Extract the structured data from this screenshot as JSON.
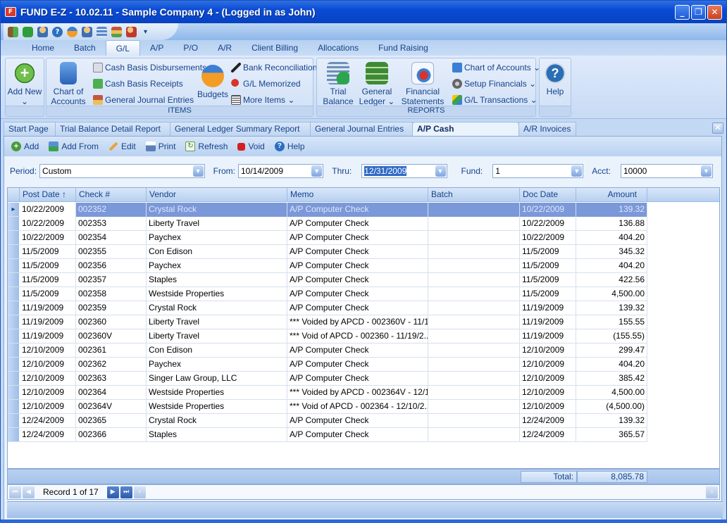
{
  "window": {
    "title": "FUND E-Z - 10.02.11 - Sample Company 4 - (Logged in as John)",
    "controls": {
      "minimize": "_",
      "restore": "❐",
      "close": "✕"
    }
  },
  "quick_access": {
    "icons": [
      "exit-icon",
      "database-icon",
      "user-icon",
      "help-icon",
      "budget-icon",
      "users-icon",
      "calculator-icon",
      "books-icon",
      "people-icon"
    ],
    "more": "▾"
  },
  "ribbon_tabs": [
    {
      "label": "Home"
    },
    {
      "label": "Batch"
    },
    {
      "label": "G/L",
      "active": true
    },
    {
      "label": "A/P"
    },
    {
      "label": "P/O"
    },
    {
      "label": "A/R"
    },
    {
      "label": "Client Billing"
    },
    {
      "label": "Allocations"
    },
    {
      "label": "Fund Raising"
    }
  ],
  "ribbon": {
    "add_new": {
      "line1": "Add New",
      "line2": "⌄"
    },
    "items_group": {
      "label": "ITEMS",
      "chart_of_accounts": {
        "line1": "Chart of",
        "line2": "Accounts ⌄"
      },
      "cash_basis_disbursements": "Cash Basis Disbursements",
      "cash_basis_receipts": "Cash Basis Receipts",
      "general_journal_entries": "General Journal Entries",
      "budgets": "Budgets",
      "bank_reconciliations": "Bank Reconciliations",
      "gl_memorized": "G/L Memorized",
      "more_items": "More Items ⌄"
    },
    "reports_group": {
      "label": "REPORTS",
      "trial_balance": {
        "line1": "Trial",
        "line2": "Balance ⌄"
      },
      "general_ledger": {
        "line1": "General",
        "line2": "Ledger ⌄"
      },
      "financial_statements": {
        "line1": "Financial",
        "line2": "Statements ⌄"
      },
      "chart_of_accounts": "Chart of Accounts ⌄",
      "setup_financials": "Setup Financials ⌄",
      "gl_transactions": "G/L Transactions ⌄"
    },
    "help": "Help"
  },
  "doc_tabs": [
    {
      "label": "Start Page"
    },
    {
      "label": "Trial Balance Detail Report"
    },
    {
      "label": "General Ledger Summary Report"
    },
    {
      "label": "General Journal Entries"
    },
    {
      "label": "A/P Cash Disbursements",
      "active": true
    },
    {
      "label": "A/R Invoices"
    }
  ],
  "toolbar": {
    "add": "Add",
    "add_from": "Add From",
    "edit": "Edit",
    "print": "Print",
    "refresh": "Refresh",
    "void": "Void",
    "help": "Help"
  },
  "filters": {
    "period_label": "Period:",
    "period": "Custom",
    "from_label": "From:",
    "from": "10/14/2009",
    "thru_label": "Thru:",
    "thru": "12/31/2009",
    "fund_label": "Fund:",
    "fund": "1",
    "acct_label": "Acct:",
    "acct": "10000"
  },
  "grid": {
    "columns": [
      "Post Date ↑",
      "Check #",
      "Vendor",
      "Memo",
      "Batch",
      "Doc Date",
      "Amount"
    ],
    "rows": [
      [
        "10/22/2009",
        "002352",
        "Crystal Rock",
        "A/P Computer Check",
        "",
        "10/22/2009",
        "139.32"
      ],
      [
        "10/22/2009",
        "002353",
        "Liberty Travel",
        "A/P Computer Check",
        "",
        "10/22/2009",
        "136.88"
      ],
      [
        "10/22/2009",
        "002354",
        "Paychex",
        "A/P Computer Check",
        "",
        "10/22/2009",
        "404.20"
      ],
      [
        "11/5/2009",
        "002355",
        "Con Edison",
        "A/P Computer Check",
        "",
        "11/5/2009",
        "345.32"
      ],
      [
        "11/5/2009",
        "002356",
        "Paychex",
        "A/P Computer Check",
        "",
        "11/5/2009",
        "404.20"
      ],
      [
        "11/5/2009",
        "002357",
        "Staples",
        "A/P Computer Check",
        "",
        "11/5/2009",
        "422.56"
      ],
      [
        "11/5/2009",
        "002358",
        "Westside Properties",
        "A/P Computer Check",
        "",
        "11/5/2009",
        "4,500.00"
      ],
      [
        "11/19/2009",
        "002359",
        "Crystal Rock",
        "A/P Computer Check",
        "",
        "11/19/2009",
        "139.32"
      ],
      [
        "11/19/2009",
        "002360",
        "Liberty Travel",
        "*** Voided by APCD - 002360V - 11/1...",
        "",
        "11/19/2009",
        "155.55"
      ],
      [
        "11/19/2009",
        "002360V",
        "Liberty Travel",
        "*** Void of APCD - 002360 - 11/19/2...",
        "",
        "11/19/2009",
        "(155.55)"
      ],
      [
        "12/10/2009",
        "002361",
        "Con Edison",
        "A/P Computer Check",
        "",
        "12/10/2009",
        "299.47"
      ],
      [
        "12/10/2009",
        "002362",
        "Paychex",
        "A/P Computer Check",
        "",
        "12/10/2009",
        "404.20"
      ],
      [
        "12/10/2009",
        "002363",
        "Singer Law Group, LLC",
        "A/P Computer Check",
        "",
        "12/10/2009",
        "385.42"
      ],
      [
        "12/10/2009",
        "002364",
        "Westside Properties",
        "*** Voided by APCD - 002364V - 12/1...",
        "",
        "12/10/2009",
        "4,500.00"
      ],
      [
        "12/10/2009",
        "002364V",
        "Westside Properties",
        "*** Void of APCD - 002364 - 12/10/2...",
        "",
        "12/10/2009",
        "(4,500.00)"
      ],
      [
        "12/24/2009",
        "002365",
        "Crystal Rock",
        "A/P Computer Check",
        "",
        "12/24/2009",
        "139.32"
      ],
      [
        "12/24/2009",
        "002366",
        "Staples",
        "A/P Computer Check",
        "",
        "12/24/2009",
        "365.57"
      ]
    ],
    "selected_row": 0
  },
  "footer": {
    "total_label": "Total:",
    "total": "8,085.78"
  },
  "navigator": {
    "record_text": "Record 1 of 17"
  },
  "colors": {
    "title_blue": "#0a4bd6",
    "selection": "#7b98d8",
    "ribbon_text": "#15428b"
  }
}
